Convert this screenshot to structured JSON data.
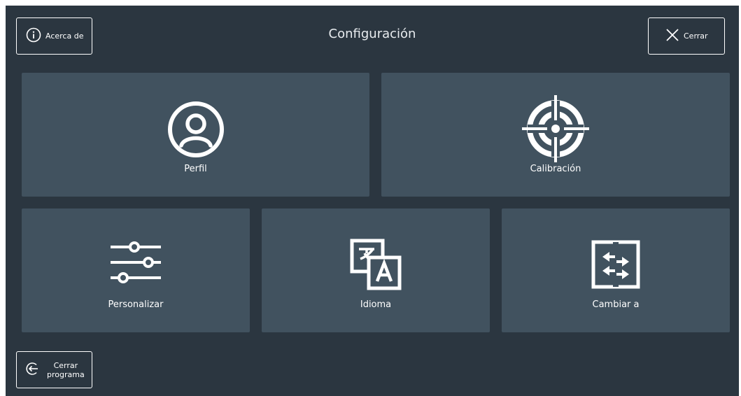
{
  "header": {
    "title": "Configuración",
    "about_label": "Acerca de",
    "close_label": "Cerrar"
  },
  "tiles": [
    {
      "label": "Perfil",
      "icon": "user-icon"
    },
    {
      "label": "Calibración",
      "icon": "target-icon"
    },
    {
      "label": "Personalizar",
      "icon": "sliders-icon"
    },
    {
      "label": "Idioma",
      "icon": "translate-icon"
    },
    {
      "label": "Cambiar a",
      "icon": "switch-arrows-icon"
    }
  ],
  "footer": {
    "exit_label_line1": "Cerrar",
    "exit_label_line2": "programa"
  },
  "colors": {
    "background": "#2b3640",
    "tile": "#41525f",
    "foreground": "#ffffff"
  }
}
